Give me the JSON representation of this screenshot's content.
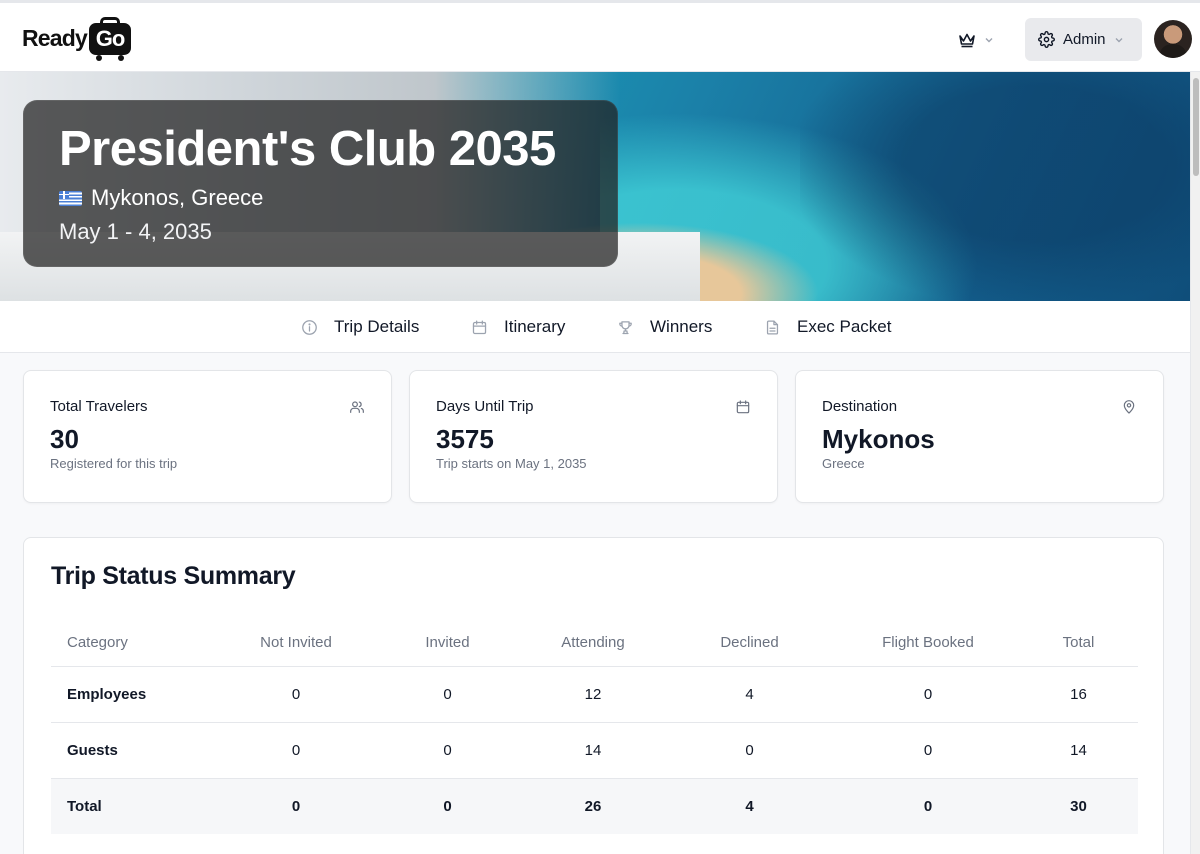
{
  "header": {
    "logo_ready": "Ready",
    "logo_go": "Go",
    "admin_label": "Admin",
    "icons": [
      "crown-icon",
      "chevron-down-icon",
      "gear-icon"
    ]
  },
  "hero": {
    "title": "President's Club 2035",
    "location": "Mykonos, Greece",
    "dates": "May 1 - 4, 2035"
  },
  "tabs": [
    {
      "label": "Trip Details",
      "icon": "info-icon"
    },
    {
      "label": "Itinerary",
      "icon": "calendar-icon"
    },
    {
      "label": "Winners",
      "icon": "trophy-icon"
    },
    {
      "label": "Exec Packet",
      "icon": "document-icon"
    }
  ],
  "stats": [
    {
      "title": "Total Travelers",
      "value": "30",
      "sub": "Registered for this trip",
      "icon": "users-icon"
    },
    {
      "title": "Days Until Trip",
      "value": "3575",
      "sub": "Trip starts on May 1, 2035",
      "icon": "calendar-icon"
    },
    {
      "title": "Destination",
      "value": "Mykonos",
      "sub": "Greece",
      "icon": "map-pin-icon"
    }
  ],
  "summary": {
    "title": "Trip Status Summary",
    "columns": [
      "Category",
      "Not Invited",
      "Invited",
      "Attending",
      "Declined",
      "Flight Booked",
      "Total"
    ],
    "rows": [
      [
        "Employees",
        "0",
        "0",
        "12",
        "4",
        "0",
        "16"
      ],
      [
        "Guests",
        "0",
        "0",
        "14",
        "0",
        "0",
        "14"
      ],
      [
        "Total",
        "0",
        "0",
        "26",
        "4",
        "0",
        "30"
      ]
    ]
  }
}
